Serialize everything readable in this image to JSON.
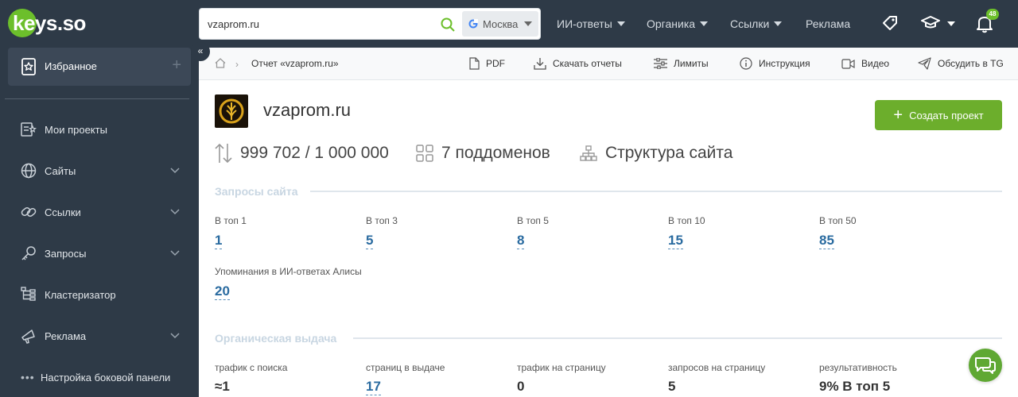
{
  "brand": {
    "logo_text": "keys.so"
  },
  "search": {
    "value": "vzaprom.ru",
    "region": "Москва"
  },
  "topnav": {
    "ai_answers": "ИИ-ответы",
    "organic": "Органика",
    "links": "Ссылки",
    "ads": "Реклама",
    "notifications_count": "48"
  },
  "sidebar": {
    "favorites": "Избранное",
    "items": [
      {
        "label": "Мои проекты",
        "icon": "projects-icon"
      },
      {
        "label": "Сайты",
        "icon": "globe-icon"
      },
      {
        "label": "Ссылки",
        "icon": "link-icon"
      },
      {
        "label": "Запросы",
        "icon": "key-icon"
      },
      {
        "label": "Кластеризатор",
        "icon": "cluster-icon"
      },
      {
        "label": "Реклама",
        "icon": "megaphone-icon"
      }
    ],
    "settings": "Настройка боковой панели"
  },
  "breadcrumb": {
    "current": "Отчет «vzaprom.ru»"
  },
  "toolbar": {
    "pdf": "PDF",
    "download": "Скачать отчеты",
    "limits": "Лимиты",
    "instruction": "Инструкция",
    "video": "Видео",
    "discuss": "Обсудить в TG"
  },
  "report": {
    "domain": "vzaprom.ru",
    "create_button": "Создать проект",
    "limits_value": "999 702 / 1 000 000",
    "subdomains": "7 поддоменов",
    "structure": "Структура сайта"
  },
  "queries": {
    "title": "Запросы сайта",
    "metrics": [
      {
        "label": "В топ 1",
        "value": "1"
      },
      {
        "label": "В топ 3",
        "value": "5"
      },
      {
        "label": "В топ 5",
        "value": "8"
      },
      {
        "label": "В топ 10",
        "value": "15"
      },
      {
        "label": "В топ 50",
        "value": "85"
      }
    ],
    "alice_label": "Упоминания в ИИ-ответах Алисы",
    "alice_value": "20"
  },
  "organic": {
    "title": "Органическая выдача",
    "metrics": [
      {
        "label": "трафик с поиска",
        "value": "≈1"
      },
      {
        "label": "страниц в выдаче",
        "value": "17"
      },
      {
        "label": "трафик на страницу",
        "value": "0"
      },
      {
        "label": "запросов на страницу",
        "value": "5"
      },
      {
        "label": "результативность",
        "value": "9% В топ 5"
      }
    ]
  },
  "colors": {
    "accent": "#6cae2c",
    "sidebar": "#2e3a47",
    "link": "#2a6ba0"
  }
}
